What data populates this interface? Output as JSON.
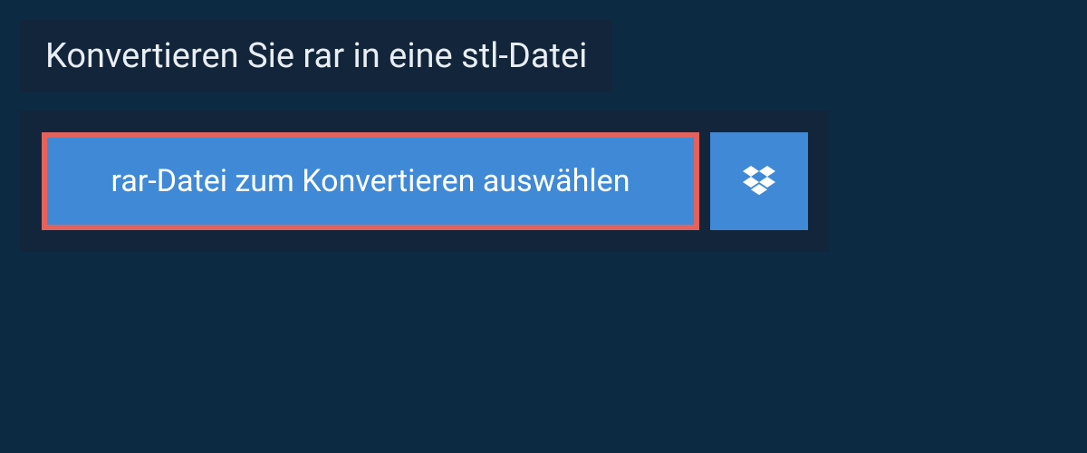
{
  "header": {
    "title": "Konvertieren Sie rar in eine stl-Datei"
  },
  "actions": {
    "select_file_label": "rar-Datei zum Konvertieren auswählen",
    "dropbox_icon": "dropbox"
  }
}
